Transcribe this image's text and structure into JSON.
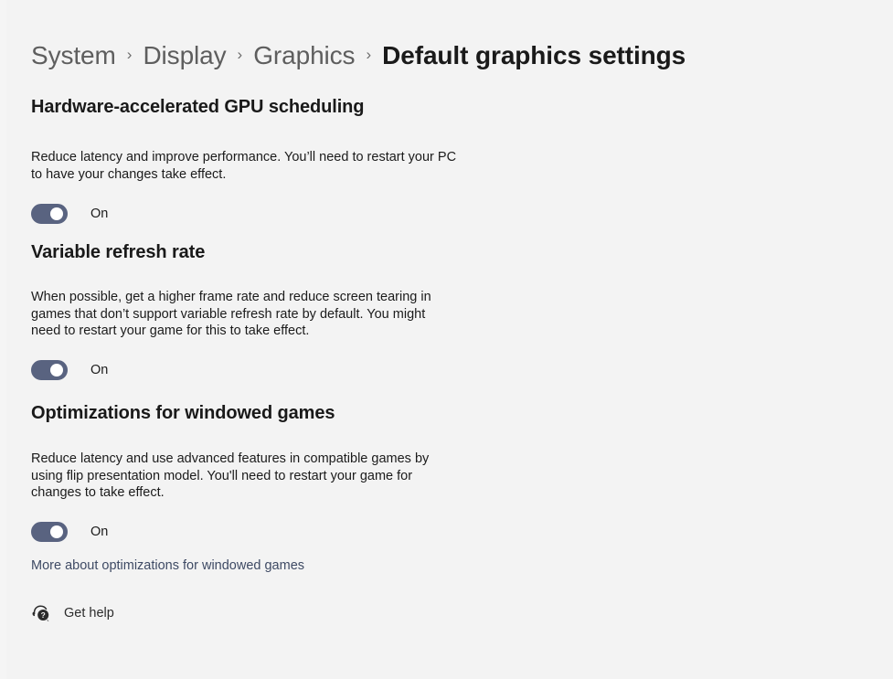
{
  "breadcrumb": {
    "separator": "›",
    "items": [
      {
        "label": "System",
        "current": false
      },
      {
        "label": "Display",
        "current": false
      },
      {
        "label": "Graphics",
        "current": false
      },
      {
        "label": "Default graphics settings",
        "current": true
      }
    ]
  },
  "sections": [
    {
      "title": "Hardware-accelerated GPU scheduling",
      "description": "Reduce latency and improve performance. You’ll need to restart your PC\nto have your changes take effect.",
      "toggle": {
        "state": "On",
        "label": "On",
        "checked": true
      }
    },
    {
      "title": "Variable refresh rate",
      "description": "When possible, get a higher frame rate and reduce screen tearing in\ngames that don’t support variable refresh rate by default. You might\nneed to restart your game for this to take effect.",
      "toggle": {
        "state": "On",
        "label": "On",
        "checked": true
      }
    },
    {
      "title": "Optimizations for windowed games",
      "description": "Reduce latency and use advanced features in compatible games by\nusing flip presentation model. You'll need to restart your game for\nchanges to take effect.",
      "toggle": {
        "state": "On",
        "label": "On",
        "checked": true
      },
      "link": "More about optimizations for windowed games"
    }
  ],
  "get_help": {
    "label": "Get help",
    "icon": "help-headset-icon"
  },
  "colors": {
    "background": "#f3f3f3",
    "toggle_on": "#596380",
    "toggle_knob": "#ffffff",
    "link": "#3e4a64",
    "text": "#1b1b1b",
    "breadcrumb_inactive": "#5e5e5e",
    "breadcrumb_current": "#1a1a1a"
  }
}
